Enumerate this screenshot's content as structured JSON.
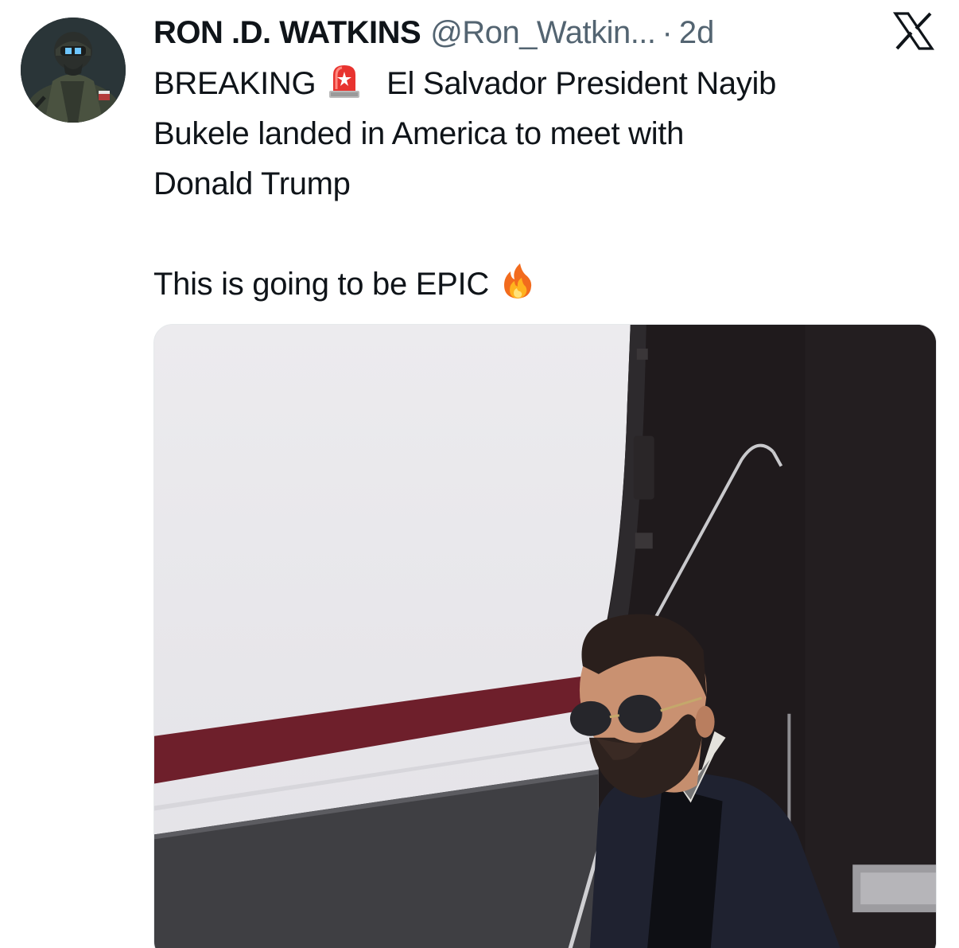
{
  "tweet": {
    "author_name": "RON .D. WATKINS",
    "handle": "@Ron_Watkin...",
    "separator": "·",
    "time": "2d",
    "lines": [
      "BREAKING",
      "El Salvador President Nayib",
      "Bukele landed in America to meet with",
      "Donald Trump",
      "This is going to be EPIC"
    ],
    "emojis": [
      "police-light-emoji",
      "fire-emoji"
    ]
  },
  "icons": {
    "close": "x-logo-icon",
    "avatar": "avatar-soldier-image"
  },
  "colors": {
    "text": "#0f1419",
    "muted": "#536471",
    "background": "#ffffff"
  }
}
